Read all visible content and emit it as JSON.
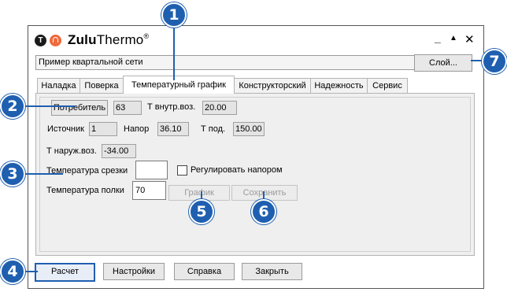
{
  "app": {
    "title_bold": "Zulu",
    "title_rest": "Thermo",
    "title_mark": "®",
    "logo_letter": "T",
    "minimize": "_",
    "maximize": "▲",
    "close": "✕"
  },
  "network_name": "Пример квартальной сети",
  "layer_button": "Слой...",
  "tabs": [
    {
      "label": "Наладка",
      "active": false
    },
    {
      "label": "Поверка",
      "active": false
    },
    {
      "label": "Температурный график",
      "active": true
    },
    {
      "label": "Конструкторский",
      "active": false
    },
    {
      "label": "Надежность",
      "active": false
    },
    {
      "label": "Сервис",
      "active": false
    }
  ],
  "form": {
    "consumer_button": "Потребитель",
    "consumer_value": "63",
    "t_inner_label": "Т внутр.воз.",
    "t_inner_value": "20.00",
    "source_label": "Источник",
    "source_value": "1",
    "head_label": "Напор",
    "head_value": "36.10",
    "t_supply_label": "Т под.",
    "t_supply_value": "150.00",
    "t_outer_label": "Т наруж.воз.",
    "t_outer_value": "-34.00",
    "cutoff_label": "Температура срезки",
    "cutoff_value": "",
    "regulate_label": "Регулировать напором",
    "regulate_checked": false,
    "shelf_label": "Температура полки",
    "shelf_value": "70",
    "graph_button": "График",
    "save_button": "Сохранить"
  },
  "bottom_buttons": {
    "calc": "Расчет",
    "settings": "Настройки",
    "help": "Справка",
    "close": "Закрыть"
  },
  "callouts": [
    "1",
    "2",
    "3",
    "4",
    "5",
    "6",
    "7"
  ],
  "colors": {
    "callout": "#1f5fb0",
    "logo_orange": "#ee6a3c"
  }
}
